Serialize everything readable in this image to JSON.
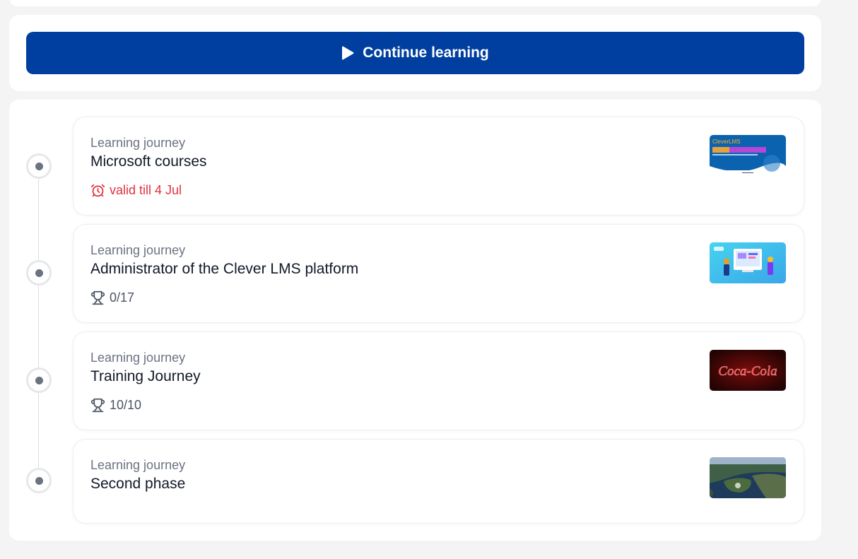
{
  "continue": {
    "label": "Continue learning",
    "icon": "play-icon",
    "color": "#003f9f"
  },
  "journeys": [
    {
      "kind": "Learning journey",
      "title": "Microsoft courses",
      "meta": "valid till 4 Jul",
      "meta_icon": "alarm-clock-icon",
      "meta_color": "#e0313f",
      "thumb_text": "CleverLMS"
    },
    {
      "kind": "Learning journey",
      "title": "Administrator of the Clever LMS platform",
      "meta": "0/17",
      "meta_icon": "trophy-icon"
    },
    {
      "kind": "Learning journey",
      "title": "Training Journey",
      "meta": "10/10",
      "meta_icon": "trophy-icon",
      "thumb_text": "Coca-Cola"
    },
    {
      "kind": "Learning journey",
      "title": "Second phase"
    }
  ]
}
